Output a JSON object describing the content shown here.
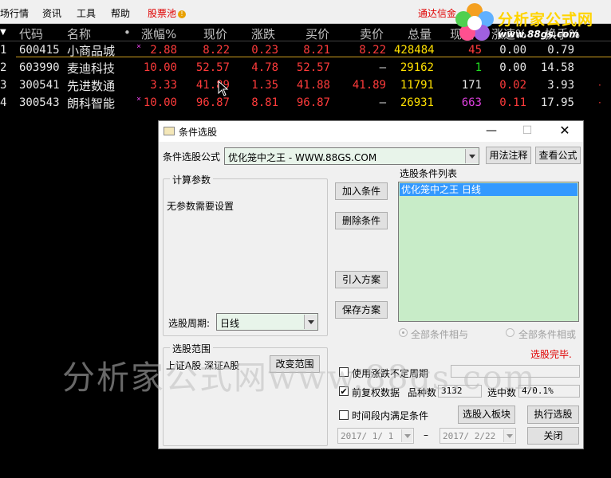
{
  "menu": {
    "items": [
      "场行情",
      "资讯",
      "工具",
      "帮助"
    ],
    "pool": "股票池",
    "comm": "通达信金"
  },
  "logo": {
    "text": "分析家公式网",
    "url": "www.88gs.com"
  },
  "quote_table": {
    "headers": [
      "代码",
      "名称",
      "•",
      "涨幅%",
      "现价",
      "涨跌",
      "买价",
      "卖价",
      "总量",
      "现量",
      "涨速%",
      "换手%"
    ],
    "rows": [
      {
        "idx": "1",
        "code": "600415",
        "name": "小商品城",
        "mark": "×",
        "chg_pct": "2.88",
        "price": "8.22",
        "chg": "0.23",
        "bid": "8.21",
        "ask": "8.22",
        "volume": "428484",
        "cur_vol": "45",
        "speed": "0.00",
        "turnover": "0.79"
      },
      {
        "idx": "2",
        "code": "603990",
        "name": "麦迪科技",
        "mark": "",
        "chg_pct": "10.00",
        "price": "52.57",
        "chg": "4.78",
        "bid": "52.57",
        "ask": "—",
        "volume": "29162",
        "cur_vol": "1",
        "speed": "0.00",
        "turnover": "14.58"
      },
      {
        "idx": "3",
        "code": "300541",
        "name": "先进数通",
        "mark": "",
        "chg_pct": "3.33",
        "price": "41.89",
        "chg": "1.35",
        "bid": "41.88",
        "ask": "41.89",
        "volume": "11791",
        "cur_vol": "171",
        "speed": "0.02",
        "turnover": "3.93"
      },
      {
        "idx": "4",
        "code": "300543",
        "name": "朗科智能",
        "mark": "×",
        "chg_pct": "10.00",
        "price": "96.87",
        "chg": "8.81",
        "bid": "96.87",
        "ask": "—",
        "volume": "26931",
        "cur_vol": "663",
        "speed": "0.11",
        "turnover": "17.95"
      }
    ]
  },
  "watermark": "分析家公式网www.88gs.com",
  "dialog": {
    "title": "条件选股",
    "formula_label": "条件选股公式",
    "formula_value": "优化笼中之王 - WWW.88GS.COM",
    "usage_button": "用法注释",
    "view_formula_button": "查看公式",
    "params_group": "计算参数",
    "params_text": "无参数需要设置",
    "period_label": "选股周期:",
    "period_value": "日线",
    "add_condition": "加入条件",
    "delete_condition": "删除条件",
    "import_scheme": "引入方案",
    "save_scheme": "保存方案",
    "list_label": "选股条件列表",
    "list_items": [
      "优化笼中之王  日线"
    ],
    "radio_and": "全部条件相与",
    "radio_or": "全部条件相或",
    "status": "选股完毕.",
    "range_group": "选股范围",
    "range_text": "上证A股 深证A股",
    "change_range": "改变范围",
    "use_irregular": "使用涨跌不定周期",
    "forward_adjust": "前复权数据",
    "count_label": "品种数",
    "count_value": "3132",
    "selected_label": "选中数",
    "selected_value": "4/0.1%",
    "time_range": "时间段内满足条件",
    "to_block": "选股入板块",
    "execute": "执行选股",
    "start_date": "2017/ 1/ 1",
    "dash": "–",
    "end_date": "2017/ 2/22",
    "close": "关闭"
  },
  "colors": {
    "rise": "#ff3b3b",
    "volume": "#ffe000",
    "selection": "#3399ff",
    "list_bg": "#c8ecc8"
  }
}
